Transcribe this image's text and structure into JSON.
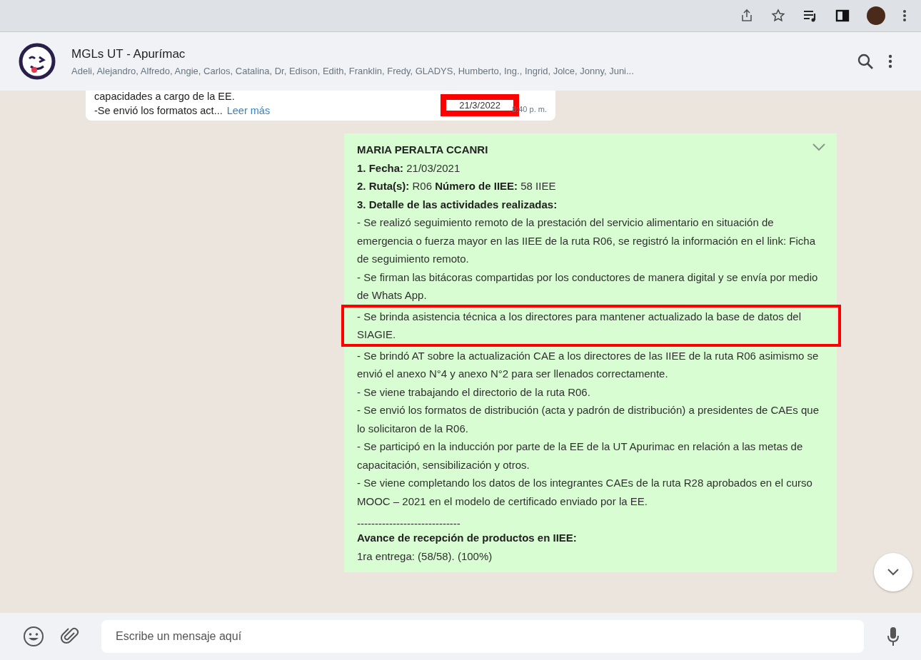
{
  "chat": {
    "title": "MGLs UT - Apurímac",
    "members": "Adeli, Alejandro, Alfredo, Angie, Carlos, Catalina, Dr, Edison, Edith, Franklin, Fredy, GLADYS, Humberto, Ing., Ingrid, Jolce, Jonny, Juni..."
  },
  "previous_message": {
    "lines": [
      "capacidades a cargo de la EE.",
      "-Se envió los formatos act..."
    ],
    "read_more": "Leer más",
    "date": "21/3/2022",
    "date_highlighted": true,
    "time": "8:40 p. m."
  },
  "message": {
    "items": [
      {
        "kind": "sender",
        "text": "**MARIA PERALTA CCANRI**",
        "highlighted": false
      },
      {
        "kind": "text",
        "text": "**1. Fecha:** 21/03/2021",
        "highlighted": false
      },
      {
        "kind": "text",
        "text": "**2. Ruta(s):** R06    **Número de IIEE:** 58 IIEE",
        "highlighted": false
      },
      {
        "kind": "heading",
        "text": "**3. Detalle de las actividades realizadas:**",
        "highlighted": false
      },
      {
        "kind": "text",
        "text": "- Se realizó seguimiento remoto de la prestación del servicio alimentario en situación de emergencia o fuerza mayor en las IIEE de la ruta R06, se registró la información en el link: Ficha de seguimiento remoto.",
        "highlighted": false
      },
      {
        "kind": "text",
        "text": "- Se firman las bitácoras compartidas por los conductores de manera digital y se envía por medio de Whats App.",
        "highlighted": false
      },
      {
        "kind": "text",
        "text": "- Se brinda asistencia técnica a los directores para mantener actualizado la base de datos del SIAGIE.",
        "highlighted": true
      },
      {
        "kind": "text",
        "text": "- Se brindó AT sobre la actualización CAE a los directores de las IIEE de la ruta R06 asimismo se envió el anexo N°4 y anexo N°2 para ser llenados correctamente.",
        "highlighted": false
      },
      {
        "kind": "text",
        "text": "- Se viene trabajando el directorio de la ruta R06.",
        "highlighted": false
      },
      {
        "kind": "text",
        "text": "- Se envió los formatos de distribución (acta y padrón de distribución) a presidentes de CAEs que lo solicitaron de la R06.",
        "highlighted": false
      },
      {
        "kind": "text",
        "text": "- Se participó en la inducción por parte de la EE de la UT Apurimac en relación a las metas de capacitación, sensibilización y otros.",
        "highlighted": false
      },
      {
        "kind": "text",
        "text": "- Se viene completando los datos de los integrantes CAEs de la ruta R28 aprobados en el curso MOOC – 2021 en el modelo de certificado enviado por la EE.",
        "highlighted": false
      },
      {
        "kind": "divider",
        "text": "-----------------------------",
        "highlighted": false
      },
      {
        "kind": "heading",
        "text": "**Avance de recepción de productos en IIEE:**",
        "highlighted": false
      },
      {
        "kind": "text",
        "text": "1ra entrega: (58/58). (100%)",
        "highlighted": false
      }
    ]
  },
  "composer": {
    "placeholder": "Escribe un mensaje aquí"
  }
}
